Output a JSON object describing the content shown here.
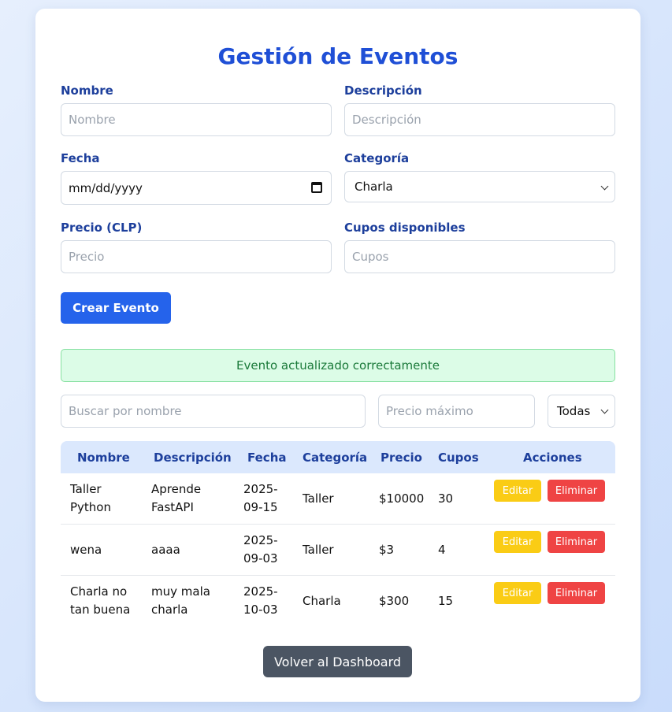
{
  "page": {
    "title": "Gestión de Eventos"
  },
  "form": {
    "nombre": {
      "label": "Nombre",
      "placeholder": "Nombre",
      "value": ""
    },
    "descripcion": {
      "label": "Descripción",
      "placeholder": "Descripción",
      "value": ""
    },
    "fecha": {
      "label": "Fecha",
      "value": "mm/dd/yyyy",
      "icon": "calendar-icon"
    },
    "categoria": {
      "label": "Categoría",
      "selected": "Charla"
    },
    "precio": {
      "label": "Precio (CLP)",
      "placeholder": "Precio",
      "value": ""
    },
    "cupos": {
      "label": "Cupos disponibles",
      "placeholder": "Cupos",
      "value": ""
    },
    "submit_label": "Crear Evento"
  },
  "alert": {
    "message": "Evento actualizado correctamente",
    "type": "success"
  },
  "filters": {
    "search_placeholder": "Buscar por nombre",
    "max_price_placeholder": "Precio máximo",
    "category_selected": "Todas"
  },
  "table": {
    "headers": [
      "Nombre",
      "Descripción",
      "Fecha",
      "Categoría",
      "Precio",
      "Cupos",
      "Acciones"
    ],
    "rows": [
      {
        "nombre": [
          "Taller",
          "Python"
        ],
        "descripcion": [
          "Aprende",
          "FastAPI"
        ],
        "fecha": [
          "2025-",
          "09-15"
        ],
        "categoria": "Taller",
        "precio": "$10000",
        "cupos": "30",
        "edit": "Editar",
        "delete": "Eliminar"
      },
      {
        "nombre": [
          "wena"
        ],
        "descripcion": [
          "aaaa"
        ],
        "fecha": [
          "2025-",
          "09-03"
        ],
        "categoria": "Taller",
        "precio": "$3",
        "cupos": "4",
        "edit": "Editar",
        "delete": "Eliminar"
      },
      {
        "nombre": [
          "Charla no",
          "tan buena"
        ],
        "descripcion": [
          "muy mala",
          "charla"
        ],
        "fecha": [
          "2025-",
          "10-03"
        ],
        "categoria": "Charla",
        "precio": "$300",
        "cupos": "15",
        "edit": "Editar",
        "delete": "Eliminar"
      }
    ]
  },
  "footer": {
    "back_label": "Volver al Dashboard"
  },
  "colors": {
    "accent": "#2563eb",
    "title": "#1f4fd6",
    "edit": "#facc15",
    "delete": "#ef4444",
    "success_bg": "#dcfce7"
  }
}
